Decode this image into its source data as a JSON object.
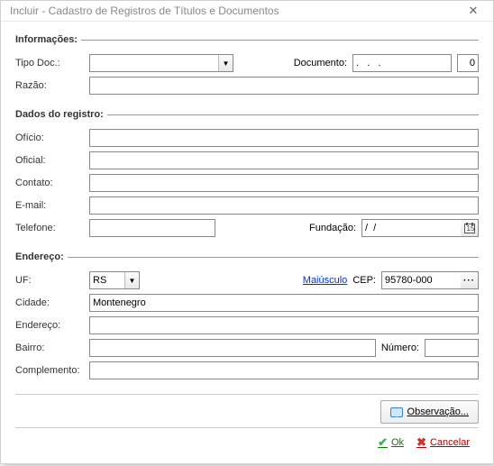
{
  "window": {
    "title": "Incluir - Cadastro de Registros de Títulos e Documentos"
  },
  "groups": {
    "info": "Informações:",
    "dados": "Dados do registro:",
    "endereco": "Endereço:"
  },
  "labels": {
    "tipoDoc": "Tipo Doc.:",
    "documento": "Documento:",
    "razao": "Razão:",
    "oficio": "Ofício:",
    "oficial": "Oficial:",
    "contato": "Contato:",
    "email": "E-mail:",
    "telefone": "Telefone:",
    "fundacao": "Fundação:",
    "uf": "UF:",
    "maiusculo": "Maiúsculo",
    "cep": "CEP:",
    "cidade": "Cidade:",
    "endereco": "Endereço:",
    "bairro": "Bairro:",
    "numero": "Número:",
    "complemento": "Complemento:"
  },
  "values": {
    "tipoDoc": "",
    "documento": ".   .   .",
    "codigo": "0",
    "razao": "",
    "oficio": "",
    "oficial": "",
    "contato": "",
    "email": "",
    "telefone": "",
    "fundacao": "/  /",
    "uf": "RS",
    "cep": "95780-000",
    "cidade": "Montenegro",
    "endereco": "",
    "bairro": "",
    "numero": "",
    "complemento": ""
  },
  "buttons": {
    "observacao": "Observação...",
    "ok": "Ok",
    "cancelar": "Cancelar"
  }
}
